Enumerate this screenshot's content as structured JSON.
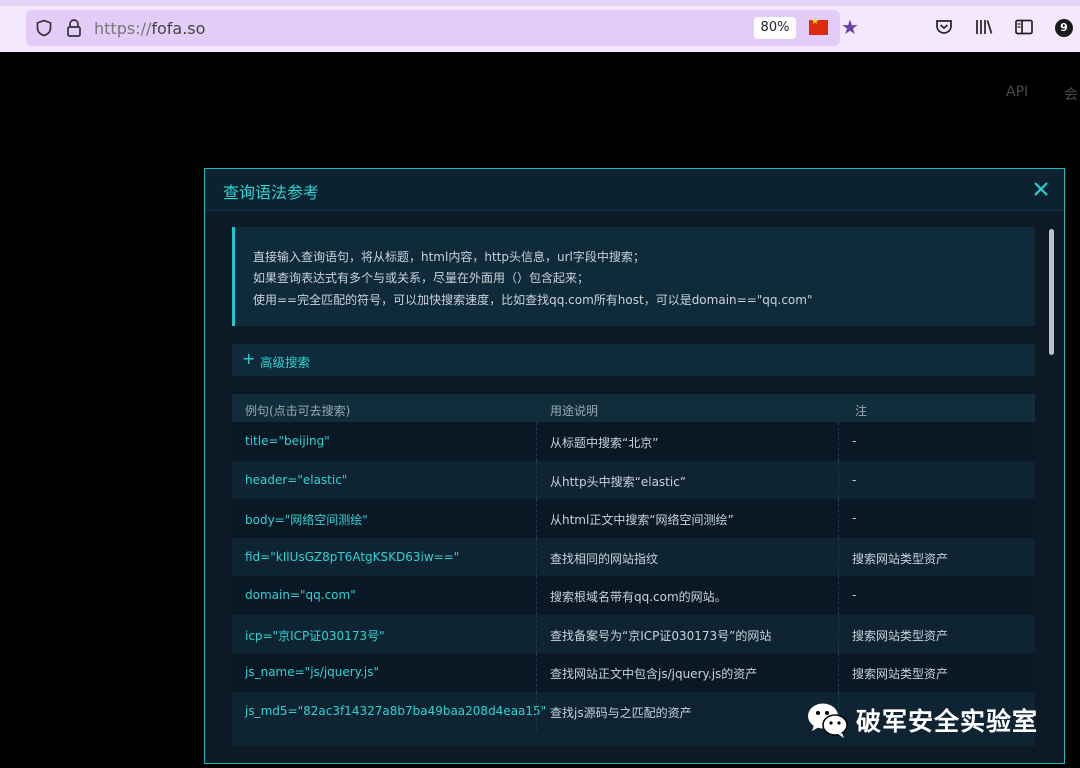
{
  "browser": {
    "url_scheme": "https://",
    "url_host": "fofa.so",
    "zoom": "80%",
    "tab_count": "9",
    "flag_icon": "china-flag-icon"
  },
  "site_nav": {
    "api": "API",
    "member": "会"
  },
  "modal": {
    "title": "查询语法参考",
    "info_lines": [
      "直接输入查询语句，将从标题，html内容，http头信息，url字段中搜索；",
      "如果查询表达式有多个与或关系，尽量在外面用（）包含起来；",
      "使用==完全匹配的符号，可以加快搜索速度，比如查找qq.com所有host，可以是domain==\"qq.com\""
    ],
    "advanced_label": "高级搜索",
    "columns": [
      "例句(点击可去搜索)",
      "用途说明",
      "注"
    ],
    "rows": [
      {
        "example": "title=\"beijing\"",
        "desc": "从标题中搜索“北京”",
        "note": "-"
      },
      {
        "example": "header=\"elastic\"",
        "desc": "从http头中搜索“elastic”",
        "note": "-"
      },
      {
        "example": "body=\"网络空间测绘\"",
        "desc": "从html正文中搜索“网络空间测绘”",
        "note": "-"
      },
      {
        "example": "fid=\"kIlUsGZ8pT6AtgKSKD63iw==\"",
        "desc": "查找相同的网站指纹",
        "note": "搜索网站类型资产"
      },
      {
        "example": "domain=\"qq.com\"",
        "desc": "搜索根域名带有qq.com的网站。",
        "note": "-"
      },
      {
        "example": "icp=\"京ICP证030173号\"",
        "desc": "查找备案号为“京ICP证030173号”的网站",
        "note": "搜索网站类型资产"
      },
      {
        "example": "js_name=\"js/jquery.js\"",
        "desc": "查找网站正文中包含js/jquery.js的资产",
        "note": "搜索网站类型资产"
      },
      {
        "example": "js_md5=\"82ac3f14327a8b7ba49baa208d4eaa15\"",
        "desc": "查找js源码与之匹配的资产",
        "note": ""
      }
    ]
  },
  "watermark": {
    "text": "破军安全实验室",
    "icon": "wechat-icon"
  },
  "colors": {
    "accent": "#2ed3d3",
    "modal_border": "#1fb8b8",
    "toolbar_bg": "#f3e8fd"
  }
}
